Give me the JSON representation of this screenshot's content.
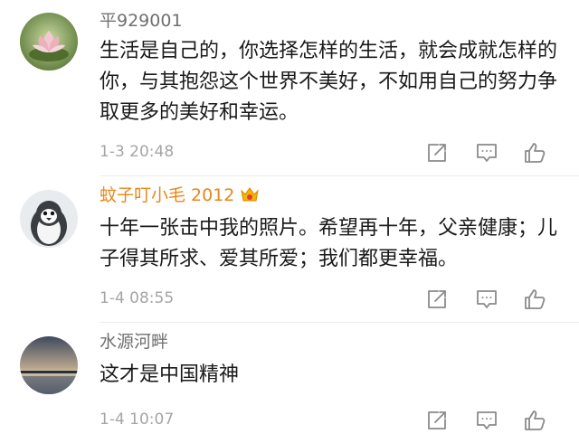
{
  "comments": [
    {
      "username": "平929001",
      "avatar_icon": "lotus-avatar",
      "text": "生活是自己的，你选择怎样的生活，就会成就怎样的你，与其抱怨这个世界不美好，不如用自己的努力争取更多的美好和幸运。",
      "time": "1-3 20:48"
    },
    {
      "username": "蚊子叮小毛 2012",
      "avatar_icon": "penguin-avatar",
      "vip_icon": "crown-badge-icon",
      "text": "十年一张击中我的照片。希望再十年，父亲健康；儿子得其所求、爱其所爱；我们都更幸福。",
      "time": "1-4 08:55"
    },
    {
      "username": "水源河畔",
      "avatar_icon": "lake-sunset-avatar",
      "text": "这才是中国精神",
      "time": "1-4 10:07"
    }
  ],
  "colors": {
    "username_default": "#707070",
    "username_vip": "#e8861a",
    "timestamp": "#a5a5a5",
    "icon": "#8a8a8a"
  }
}
